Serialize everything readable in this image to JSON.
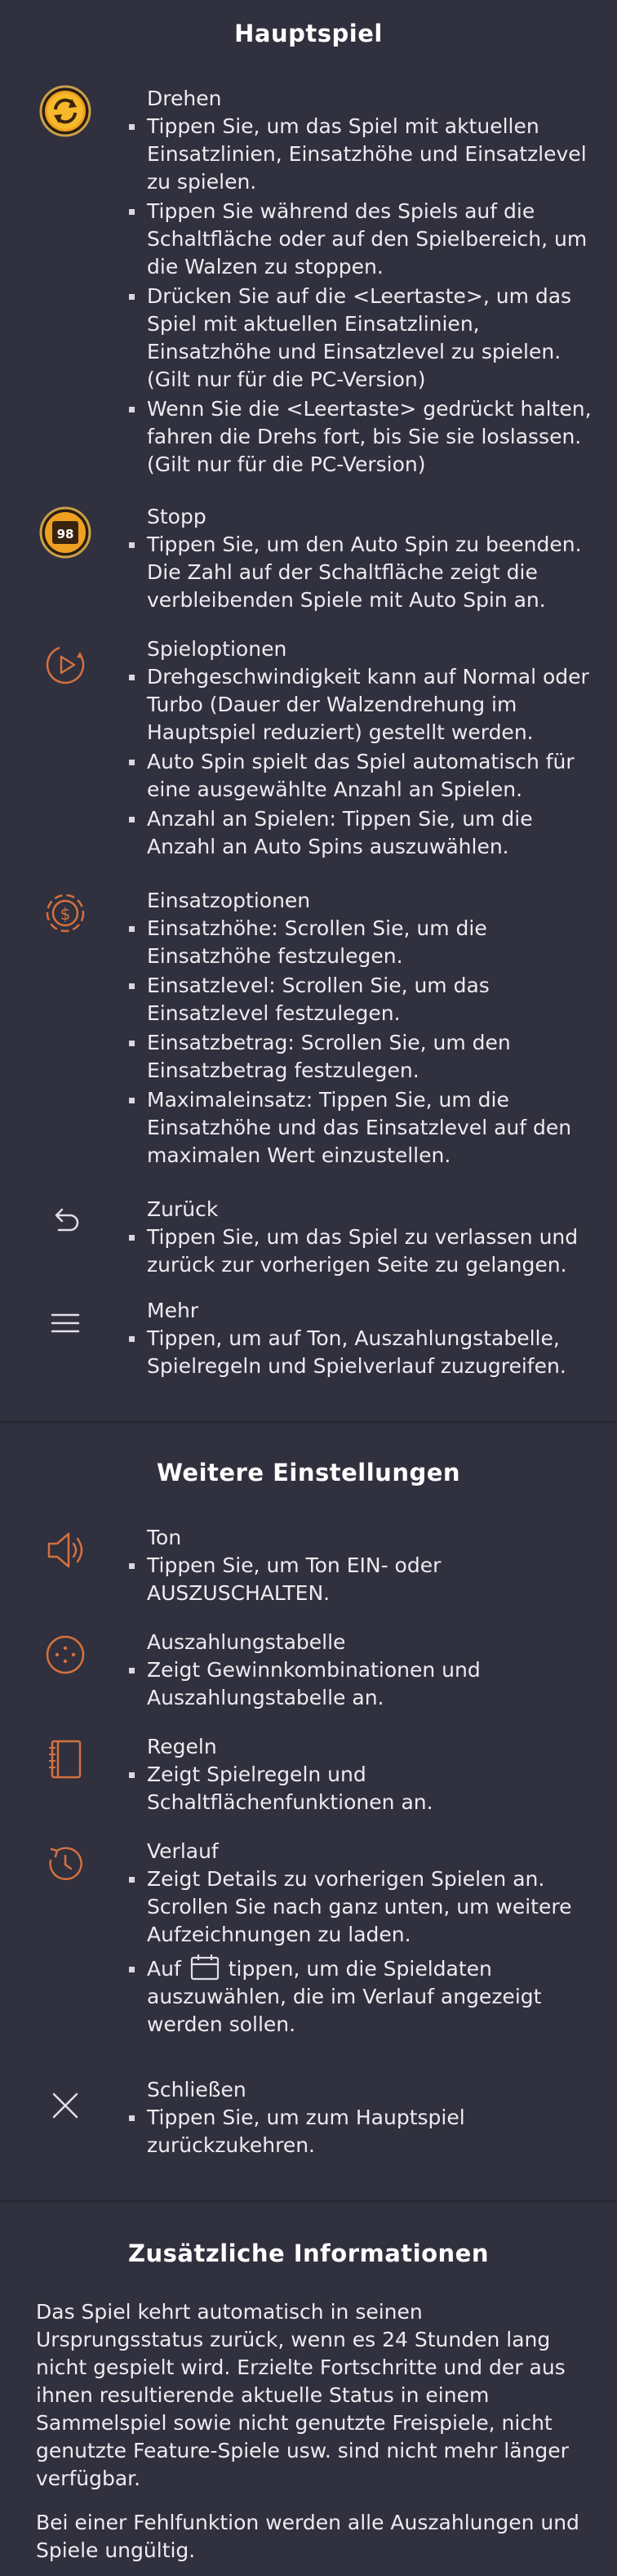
{
  "main_game": {
    "title": "Hauptspiel",
    "items": [
      {
        "icon": "spin-icon",
        "title": "Drehen",
        "bullets": [
          "Tippen Sie, um das Spiel mit aktuellen Einsatzlinien, Einsatzhöhe und Einsatzlevel zu spielen.",
          "Tippen Sie während des Spiels auf die Schaltfläche oder auf den Spielbereich, um die Walzen zu stoppen.",
          "Drücken Sie auf die <Leertaste>, um das Spiel mit aktuellen Einsatzlinien, Einsatzhöhe und Einsatzlevel zu spielen. (Gilt nur für die PC-Version)",
          "Wenn Sie die <Leertaste> gedrückt halten, fahren die Drehs fort, bis Sie sie loslassen. (Gilt nur für die PC-Version)"
        ]
      },
      {
        "icon": "stop-icon",
        "icon_label": "98",
        "title": "Stopp",
        "bullets": [
          "Tippen Sie, um den Auto Spin zu beenden. Die Zahl auf der Schaltfläche zeigt die verbleibenden Spiele mit Auto Spin an."
        ]
      },
      {
        "icon": "game-options-icon",
        "title": "Spieloptionen",
        "bullets": [
          "Drehgeschwindigkeit kann auf Normal oder Turbo (Dauer der Walzendrehung im Hauptspiel reduziert) gestellt werden.",
          "Auto Spin spielt das Spiel automatisch für eine ausgewählte Anzahl an Spielen.",
          "Anzahl an Spielen: Tippen Sie, um die Anzahl an Auto Spins auszuwählen."
        ]
      },
      {
        "icon": "bet-options-icon",
        "title": "Einsatzoptionen",
        "bullets": [
          "Einsatzhöhe: Scrollen Sie, um die Einsatzhöhe festzulegen.",
          "Einsatzlevel: Scrollen Sie, um das Einsatzlevel festzulegen.",
          "Einsatzbetrag: Scrollen Sie, um den Einsatzbetrag festzulegen.",
          "Maximaleinsatz: Tippen Sie, um die Einsatzhöhe und das Einsatzlevel auf den maximalen Wert einzustellen."
        ]
      },
      {
        "icon": "back-arrow-icon",
        "title": "Zurück",
        "bullets": [
          "Tippen Sie, um das Spiel zu verlassen und zurück zur vorherigen Seite zu gelangen."
        ]
      },
      {
        "icon": "menu-icon",
        "title": "Mehr",
        "bullets": [
          "Tippen, um auf Ton, Auszahlungstabelle, Spielregeln und Spielverlauf zuzugreifen."
        ]
      }
    ]
  },
  "more_settings": {
    "title": "Weitere Einstellungen",
    "items": [
      {
        "icon": "speaker-icon",
        "title": "Ton",
        "bullets": [
          "Tippen Sie, um Ton EIN- oder AUSZUSCHALTEN."
        ]
      },
      {
        "icon": "paytable-icon",
        "title": "Auszahlungstabelle",
        "bullets": [
          "Zeigt Gewinnkombinationen und Auszahlungstabelle an."
        ]
      },
      {
        "icon": "rules-book-icon",
        "title": "Regeln",
        "bullets": [
          "Zeigt Spielregeln und Schaltflächenfunktionen an."
        ]
      },
      {
        "icon": "history-clock-icon",
        "title": "Verlauf",
        "bullets": [
          "Zeigt Details zu vorherigen Spielen an. Scrollen Sie nach ganz unten, um weitere Aufzeichnungen zu laden."
        ],
        "calendar_bullet": {
          "before": "Auf",
          "after": "tippen, um die Spieldaten auszuwählen, die im Verlauf angezeigt werden sollen."
        }
      },
      {
        "icon": "close-x-icon",
        "title": "Schließen",
        "bullets": [
          "Tippen Sie, um zum Hauptspiel zurückzukehren."
        ]
      }
    ]
  },
  "additional_info": {
    "title": "Zusätzliche Informationen",
    "paragraphs": [
      "Das Spiel kehrt automatisch in seinen Ursprungsstatus zurück, wenn es 24 Stunden lang nicht gespielt wird. Erzielte Fortschritte und der aus ihnen resultierende aktuelle Status in einem Sammelspiel sowie nicht genutzte Freispiele, nicht genutzte Feature-Spiele usw. sind nicht mehr länger verfügbar.",
      "Bei einer Fehlfunktion werden alle Auszahlungen und Spiele ungültig."
    ]
  },
  "colors": {
    "background": "#30303e",
    "divider": "#26262f",
    "accent_orange": "#d4713f",
    "gold": "#e0b35a"
  }
}
